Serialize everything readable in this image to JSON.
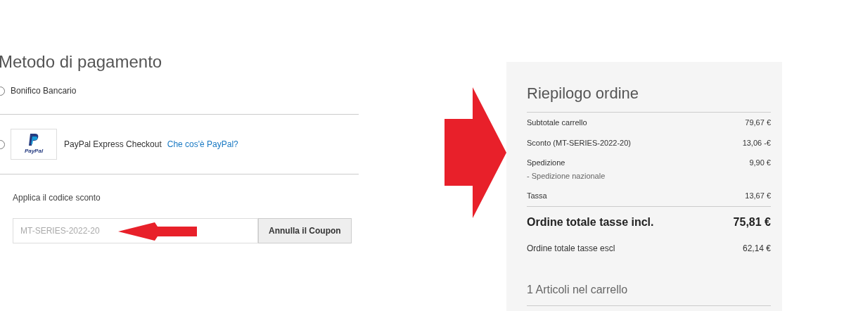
{
  "payment": {
    "title": "Metodo di pagamento",
    "methods": [
      {
        "kind": "plain",
        "label": "Bonifico Bancario",
        "selected": false
      },
      {
        "kind": "paypal",
        "label": "PayPal Express Checkout",
        "link": "Che cos'è PayPal?",
        "logo_text": "PayPal",
        "selected": false
      }
    ],
    "coupon": {
      "label": "Applica il codice sconto",
      "value": "MT-SERIES-2022-20",
      "button": "Annulla il Coupon"
    }
  },
  "summary": {
    "title": "Riepilogo ordine",
    "rows": [
      {
        "kind": "line",
        "label": "Subtotale carrello",
        "amount": "79,67 €"
      },
      {
        "kind": "line",
        "label": "Sconto (MT-SERIES-2022-20)",
        "amount": "13,06 -€"
      },
      {
        "kind": "line",
        "label": "Spedizione",
        "sublabel": "- Spedizione nazionale",
        "amount": "9,90 €"
      },
      {
        "kind": "line",
        "label": "Tassa",
        "amount": "13,67 €"
      },
      {
        "kind": "grand",
        "label": "Ordine totale tasse incl.",
        "amount": "75,81 €"
      },
      {
        "kind": "total",
        "label": "Ordine totale tasse escl",
        "amount": "62,14 €"
      }
    ],
    "items_title": "1 Articoli nel carrello"
  }
}
